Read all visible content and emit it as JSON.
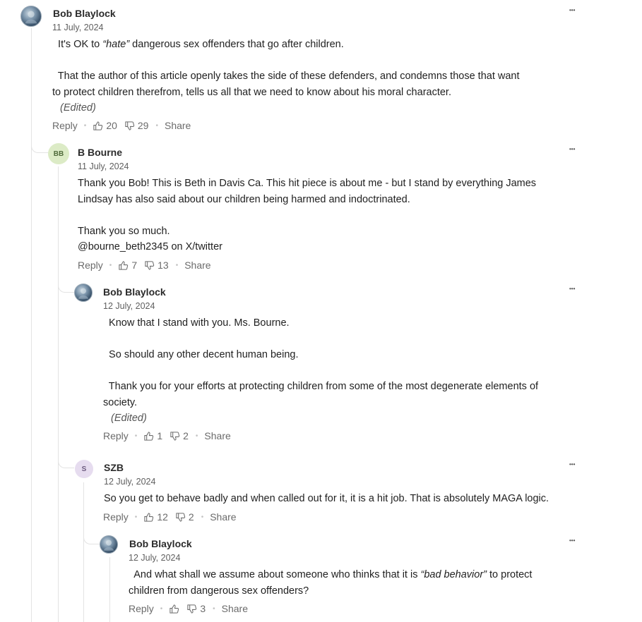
{
  "comments": [
    {
      "author": "Bob Blaylock",
      "date": "11 July, 2024",
      "paragraphs": [
        [
          "  It's OK to ",
          "“hate”",
          " dangerous sex offenders that go after children."
        ],
        [
          "  That the author of this article openly takes the side of these defenders, and condemns those that want"
        ],
        [
          "to protect children therefrom, tells us all that we need to know about his moral character."
        ]
      ],
      "edited": "(Edited)",
      "reply": "Reply",
      "likes": "20",
      "dislikes": "29",
      "share": "Share",
      "more": "•••"
    },
    {
      "author": "B Bourne",
      "avatar_initials": "BB",
      "date": "11 July, 2024",
      "lines": [
        "Thank you Bob! This is Beth in Davis Ca. This hit piece is about me - but I stand by everything James",
        "Lindsay has also said about our children being harmed and indoctrinated.",
        "Thank you so much.",
        "@bourne_beth2345 on X/twitter"
      ],
      "reply": "Reply",
      "likes": "7",
      "dislikes": "13",
      "share": "Share",
      "more": "•••"
    },
    {
      "author": "Bob Blaylock",
      "date": "12 July, 2024",
      "lines": [
        "  Know that I stand with you. Ms. Bourne.",
        "  So should any other decent human being.",
        "  Thank you for your efforts at protecting children from some of the most degenerate elements of",
        "society."
      ],
      "edited": "(Edited)",
      "reply": "Reply",
      "likes": "1",
      "dislikes": "2",
      "share": "Share",
      "more": "•••"
    },
    {
      "author": "SZB",
      "avatar_initials": "S",
      "date": "12 July, 2024",
      "lines": [
        "So you get to behave badly and when called out for it, it is a hit job.  That is absolutely MAGA logic."
      ],
      "reply": "Reply",
      "likes": "12",
      "dislikes": "2",
      "share": "Share",
      "more": "•••"
    },
    {
      "author": "Bob Blaylock",
      "date": "12 July, 2024",
      "line1_parts": [
        "  And what shall we assume about someone who thinks that it is ",
        "“bad behavior”",
        " to protect"
      ],
      "line2": "children from dangerous sex offenders?",
      "reply": "Reply",
      "likes": "",
      "dislikes": "3",
      "share": "Share",
      "more": "•••"
    }
  ],
  "icons": {
    "like": "thumbs-up-icon",
    "dislike": "thumbs-down-icon",
    "more": "more-options-icon"
  }
}
